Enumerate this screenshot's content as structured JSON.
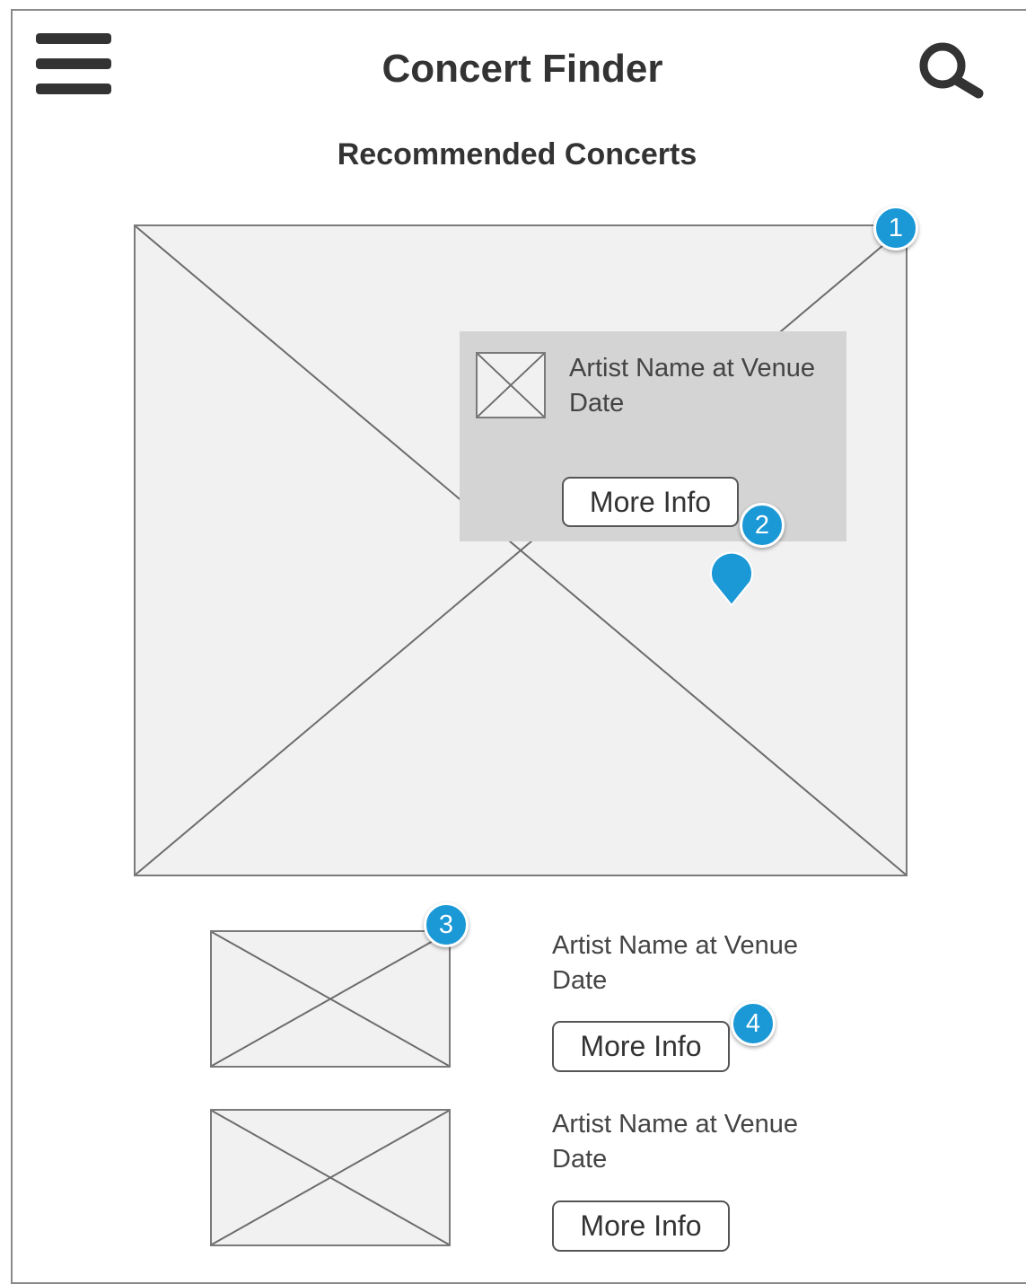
{
  "header": {
    "title": "Concert Finder",
    "menu_icon": "hamburger-menu-icon",
    "search_icon": "search-icon"
  },
  "section": {
    "title": "Recommended Concerts"
  },
  "featured": {
    "artist_line": "Artist Name at Venue",
    "date_line": "Date",
    "button_label": "More Info"
  },
  "concerts": [
    {
      "artist_line": "Artist Name at Venue",
      "date_line": "Date",
      "button_label": "More Info"
    },
    {
      "artist_line": "Artist Name at Venue",
      "date_line": "Date",
      "button_label": "More Info"
    }
  ],
  "annotations": [
    "1",
    "2",
    "3",
    "4"
  ],
  "colors": {
    "annotation_badge": "#1b98d6",
    "overlay_panel": "#d4d4d4",
    "placeholder_fill": "#f1f1f1",
    "icon_dark": "#333333"
  }
}
